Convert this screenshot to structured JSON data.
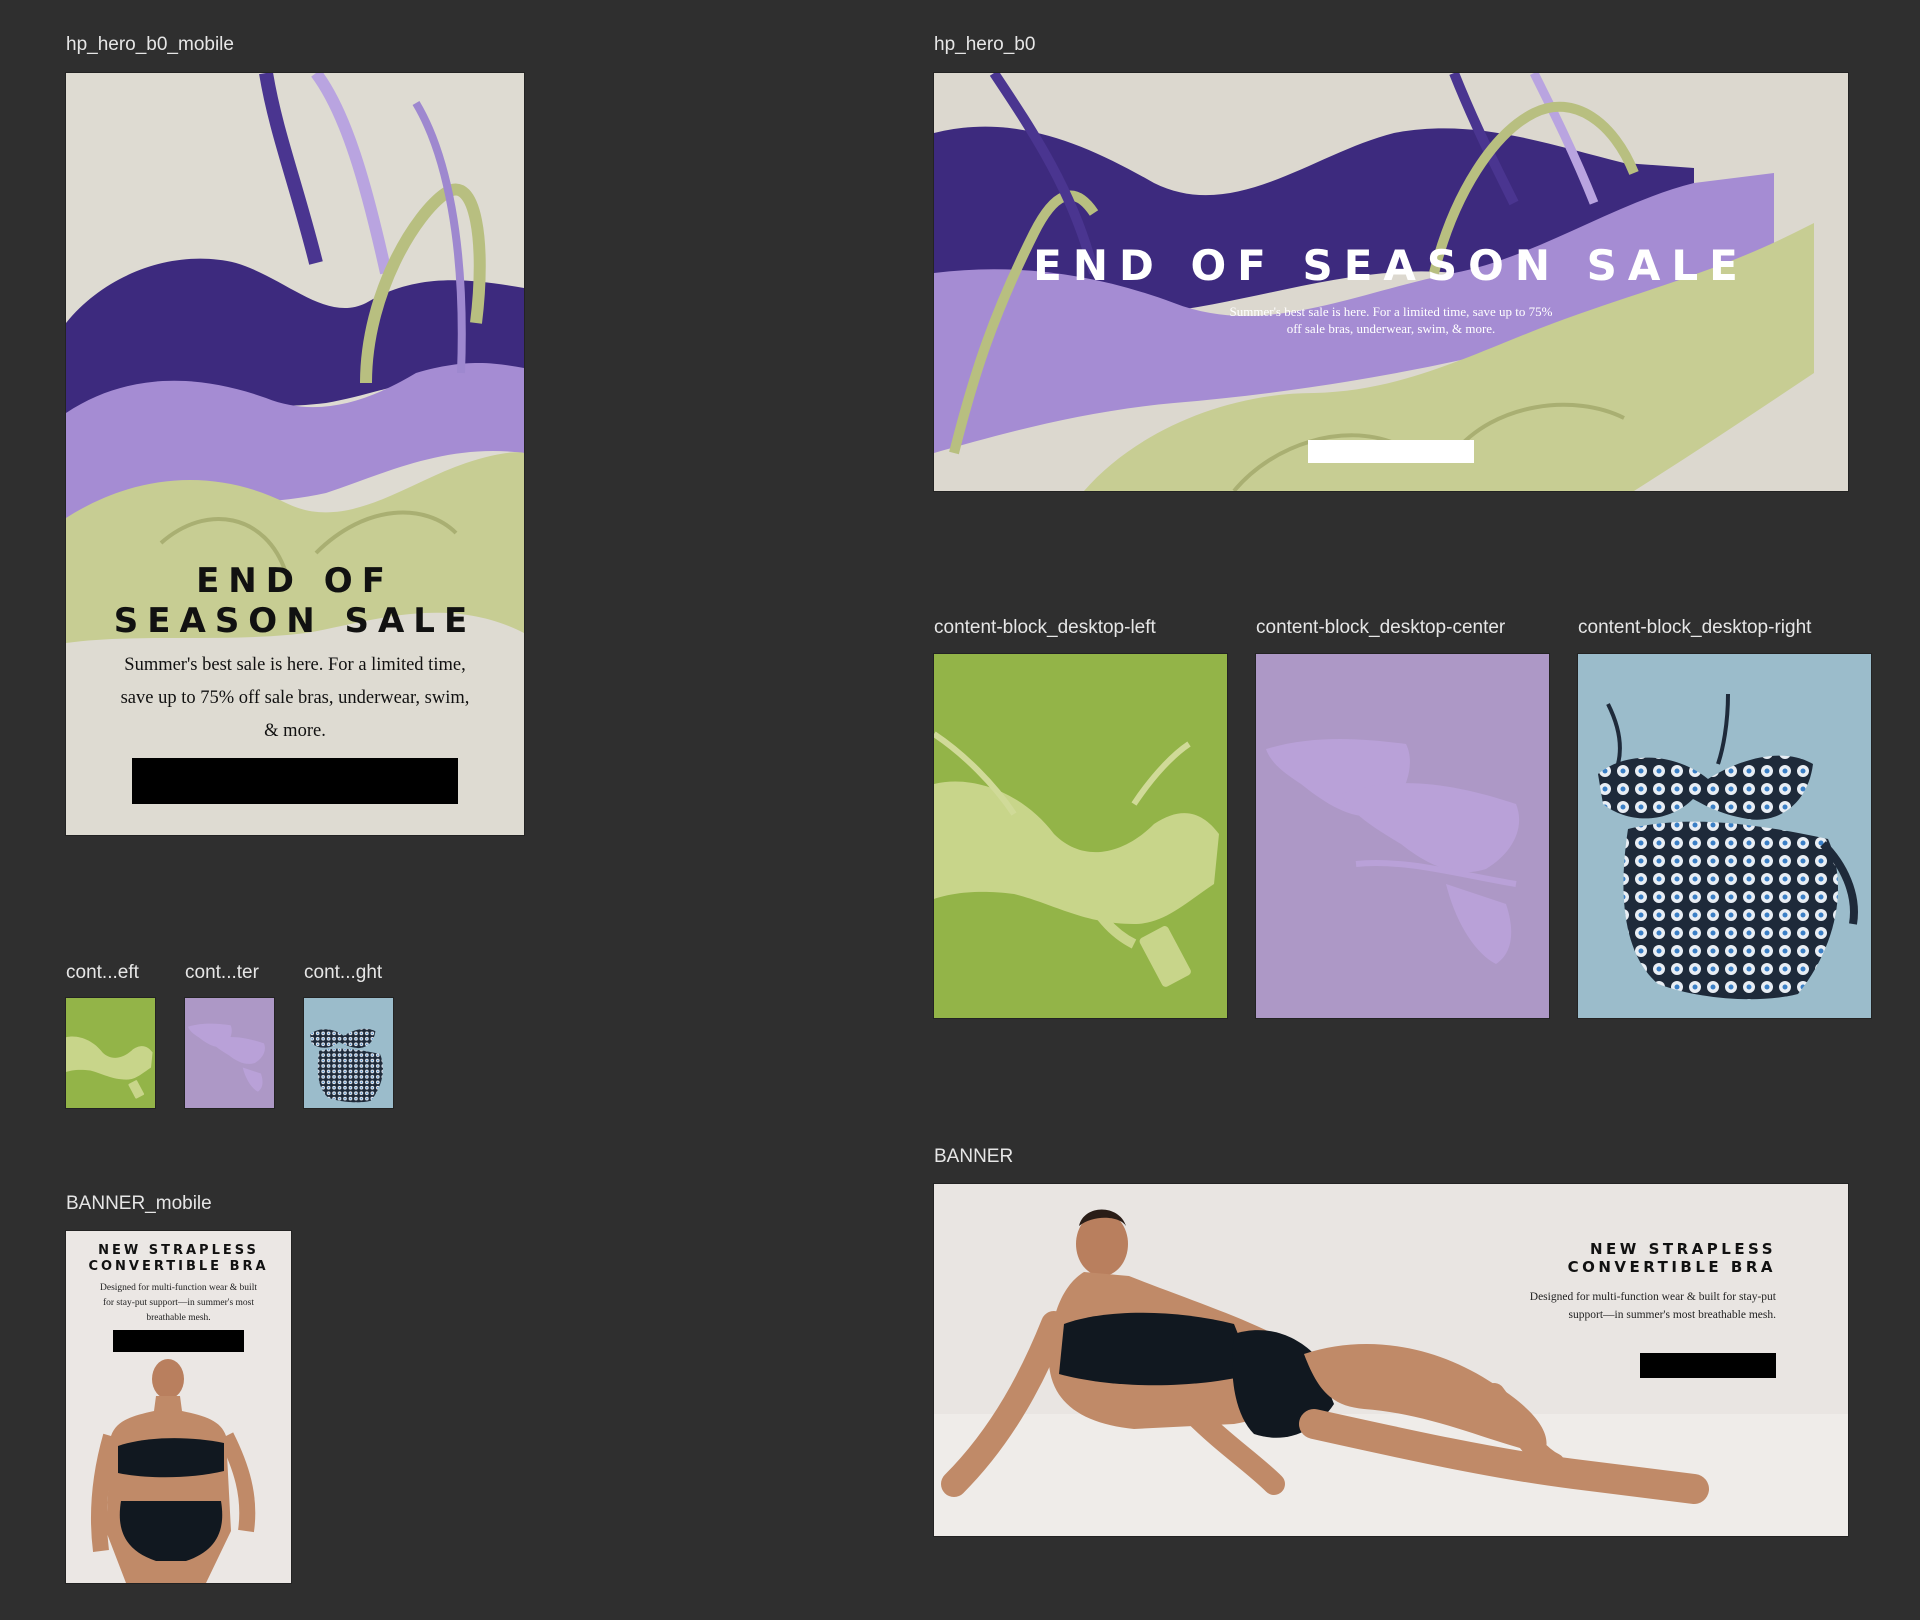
{
  "frames": {
    "hero_mobile": {
      "label": "hp_hero_b0_mobile"
    },
    "hero_desktop": {
      "label": "hp_hero_b0"
    },
    "cb_left": {
      "label": "content-block_desktop-left"
    },
    "cb_center": {
      "label": "content-block_desktop-center"
    },
    "cb_right": {
      "label": "content-block_desktop-right"
    },
    "thumb_left": {
      "label": "cont...eft"
    },
    "thumb_center": {
      "label": "cont...ter"
    },
    "thumb_right": {
      "label": "cont...ght"
    },
    "banner_mobile": {
      "label": "BANNER_mobile"
    },
    "banner_desktop": {
      "label": "BANNER"
    }
  },
  "hero": {
    "headline": "END OF SEASON SALE",
    "headline_line1": "END OF",
    "headline_line2": "SEASON SALE",
    "body_desktop_line1": "Summer's best sale is here. For a limited time, save up to 75%",
    "body_desktop_line2": "off sale bras, underwear, swim, & more.",
    "body_mobile_line1": "Summer's best sale is here. For a limited time,",
    "body_mobile_line2": "save up to 75% off sale bras, underwear, swim,",
    "body_mobile_line3": "& more."
  },
  "banner": {
    "headline_line1": "NEW STRAPLESS",
    "headline_line2": "CONVERTIBLE BRA",
    "body_desktop_line1": "Designed for multi-function wear & built for stay-put",
    "body_desktop_line2": "support—in summer's most breathable mesh.",
    "body_mobile_line1": "Designed for multi-function wear & built",
    "body_mobile_line2": "for stay-put support—in summer's most",
    "body_mobile_line3": "breathable mesh."
  },
  "colors": {
    "canvas_bg": "#2f2f2f",
    "label_text": "#e6e6e6",
    "linen": "#dedbd2",
    "indigo": "#3d2a7e",
    "lavender": "#a58cd3",
    "sage": "#c7cd93",
    "green_bg": "#93b448",
    "lilac_bg": "#ad98c6",
    "sky_bg": "#9bbccb",
    "banner_bg": "#ebe7e4",
    "ink": "#111111"
  },
  "icons": [
    "bra-photo",
    "underwear-photo",
    "swimsuit-photo",
    "model-photo"
  ]
}
